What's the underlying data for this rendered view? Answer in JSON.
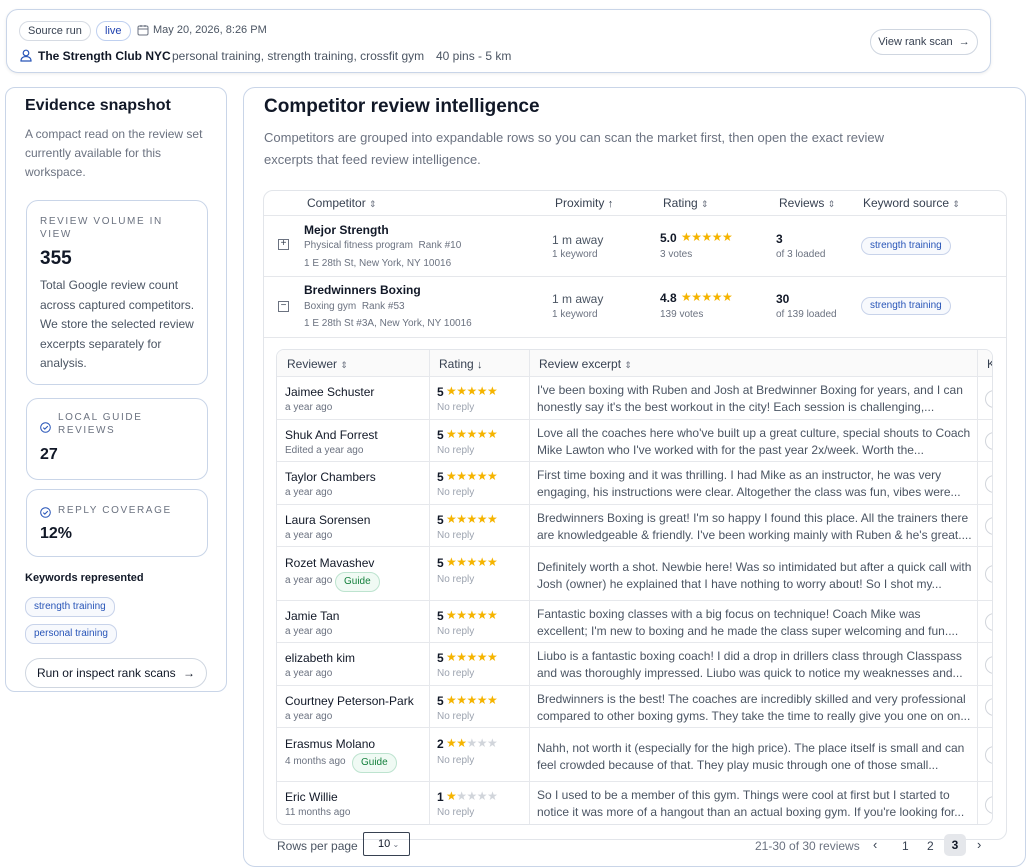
{
  "header": {
    "source_run": "Source run",
    "live": "live",
    "date": "May 20, 2026, 8:26 PM",
    "client": "The Strength Club NYC",
    "keywords": "personal training, strength training, crossfit gym",
    "pins": "40 pins - 5 km",
    "view_rank_scan": "View rank scan"
  },
  "sidebar": {
    "title": "Evidence snapshot",
    "subtitle": "A compact read on the review set currently available for this workspace.",
    "volume_label": "REVIEW VOLUME IN VIEW",
    "volume_value": "355",
    "volume_desc": "Total Google review count across captured competitors. We store the selected review excerpts separately for analysis.",
    "local_guide_label": "LOCAL GUIDE REVIEWS",
    "local_guide_value": "27",
    "reply_label": "REPLY COVERAGE",
    "reply_value": "12%",
    "keywords_title": "Keywords represented",
    "keywords": [
      "strength training",
      "personal training"
    ],
    "cta": "Run or inspect rank scans"
  },
  "main": {
    "title": "Competitor review intelligence",
    "description": "Competitors are grouped into expandable rows so you can scan the market first, then open the exact review excerpts that feed review intelligence.",
    "columns": [
      "Competitor",
      "Proximity",
      "Rating",
      "Reviews",
      "Keyword source"
    ],
    "competitors": [
      {
        "name": "Mejor Strength",
        "category": "Physical fitness program",
        "rank": "Rank #10",
        "address": "1 E 28th St, New York, NY 10016",
        "distance": "1 m away",
        "keyword_count": "1 keyword",
        "rating": "5.0",
        "votes": "3 votes",
        "reviews": "3",
        "loaded": "of 3 loaded",
        "keyword": "strength training",
        "expanded": false
      },
      {
        "name": "Bredwinners Boxing",
        "category": "Boxing gym",
        "rank": "Rank #53",
        "address": "1 E 28th St #3A, New York, NY 10016",
        "distance": "1 m away",
        "keyword_count": "1 keyword",
        "rating": "4.8",
        "votes": "139 votes",
        "reviews": "30",
        "loaded": "of 139 loaded",
        "keyword": "strength training",
        "expanded": true
      }
    ],
    "review_columns": [
      "Reviewer",
      "Rating",
      "Review excerpt"
    ],
    "review_col_extra": "K",
    "reviews": [
      {
        "name": "Jaimee Schuster",
        "date": "a year ago",
        "guide": "",
        "rating": 5,
        "reply": "No reply",
        "text": "I've been boxing with Ruben and Josh at Bredwinner Boxing for years, and I can honestly say it's the best workout in the city! Each session is challenging,..."
      },
      {
        "name": "Shuk And Forrest",
        "date": "Edited a year ago",
        "guide": "",
        "rating": 5,
        "reply": "No reply",
        "text": "Love all the coaches here who've built up a great culture, special shouts to Coach Mike Lawton who I've worked with for the past year 2x/week. Worth the..."
      },
      {
        "name": "Taylor Chambers",
        "date": "a year ago",
        "guide": "",
        "rating": 5,
        "reply": "No reply",
        "text": "First time boxing and it was thrilling. I had Mike as an instructor, he was very engaging, his instructions were clear. Altogether the class was fun, vibes were..."
      },
      {
        "name": "Laura Sorensen",
        "date": "a year ago",
        "guide": "",
        "rating": 5,
        "reply": "No reply",
        "text": "Bredwinners Boxing is great! I'm so happy I found this place. All the trainers there are knowledgeable & friendly. I've been working mainly with Ruben & he's great...."
      },
      {
        "name": "Rozet Mavashev",
        "date": "a year ago",
        "guide": "Guide",
        "rating": 5,
        "reply": "No reply",
        "text": "Definitely worth a shot. Newbie here! Was so intimidated but after a quick call with Josh (owner) he explained that I have nothing to worry about! So I shot my..."
      },
      {
        "name": "Jamie Tan",
        "date": "a year ago",
        "guide": "",
        "rating": 5,
        "reply": "No reply",
        "text": "Fantastic boxing classes with a big focus on technique! Coach Mike was excellent; I'm new to boxing and he made the class super welcoming and fun...."
      },
      {
        "name": "elizabeth kim",
        "date": "a year ago",
        "guide": "",
        "rating": 5,
        "reply": "No reply",
        "text": "Liubo is a fantastic boxing coach! I did a drop in drillers class through Classpass and was thoroughly impressed. Liubo was quick to notice my weaknesses and..."
      },
      {
        "name": "Courtney Peterson-Park",
        "date": "a year ago",
        "guide": "",
        "rating": 5,
        "reply": "No reply",
        "text": "Bredwinners is the best! The coaches are incredibly skilled and very professional compared to other boxing gyms. They take the time to really give you one on on..."
      },
      {
        "name": "Erasmus Molano",
        "date": "4 months ago",
        "guide": "Guide",
        "rating": 2,
        "reply": "No reply",
        "text": "Nahh, not worth it (especially for the high price). The place itself is small and can feel crowded because of that. They play music through one of those small..."
      },
      {
        "name": "Eric Willie",
        "date": "11 months ago",
        "guide": "",
        "rating": 1,
        "reply": "No reply",
        "text": "So I used to be a member of this gym. Things were cool at first but I started to notice it was more of a hangout than an actual boxing gym. If you're looking for..."
      }
    ],
    "rows_per_page_label": "Rows per page",
    "rows_per_page": "10",
    "range": "21-30 of 30 reviews",
    "pages": [
      "1",
      "2",
      "3"
    ],
    "current_page": "3"
  },
  "colors": {
    "accent": "#2855b8",
    "star": "#f5b400",
    "border": "#c9d5e8"
  }
}
